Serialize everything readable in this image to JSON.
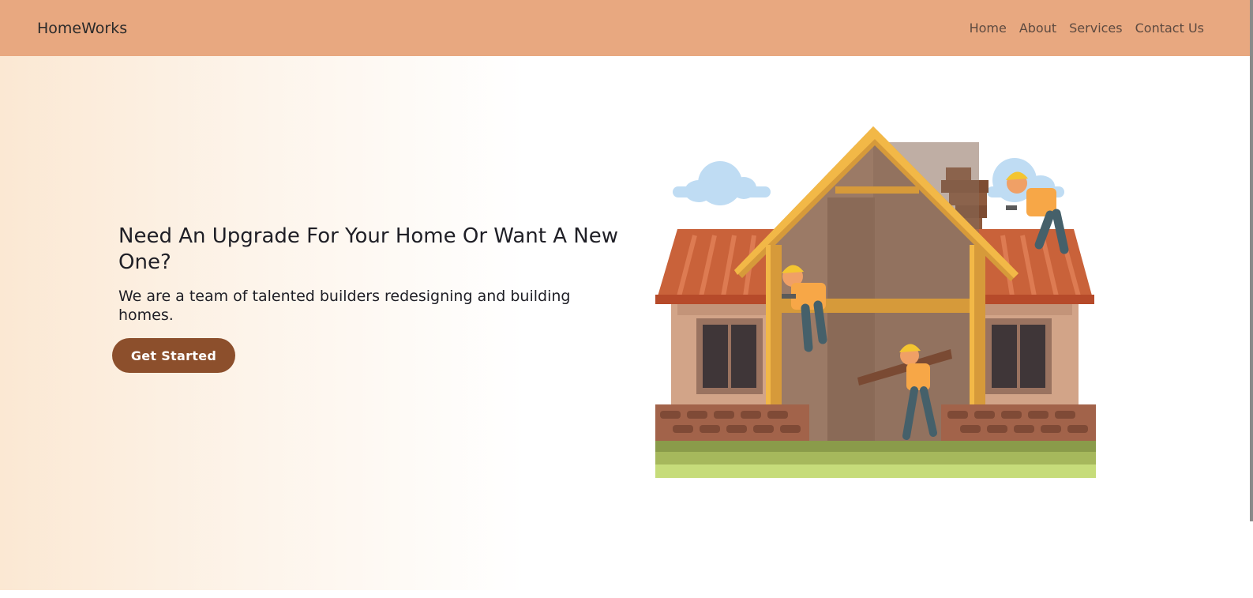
{
  "nav": {
    "brand": "HomeWorks",
    "links": [
      "Home",
      "About",
      "Services",
      "Contact Us"
    ]
  },
  "hero": {
    "heading": "Need An Upgrade For Your Home Or Want A New One?",
    "subheading": "We are a team of talented builders redesigning and building homes.",
    "cta_label": "Get Started"
  },
  "colors": {
    "navbar": "#e8a880",
    "button": "#8c4f2c",
    "text": "#1f1f26"
  },
  "illustration": {
    "subject": "house-construction-illustration"
  }
}
